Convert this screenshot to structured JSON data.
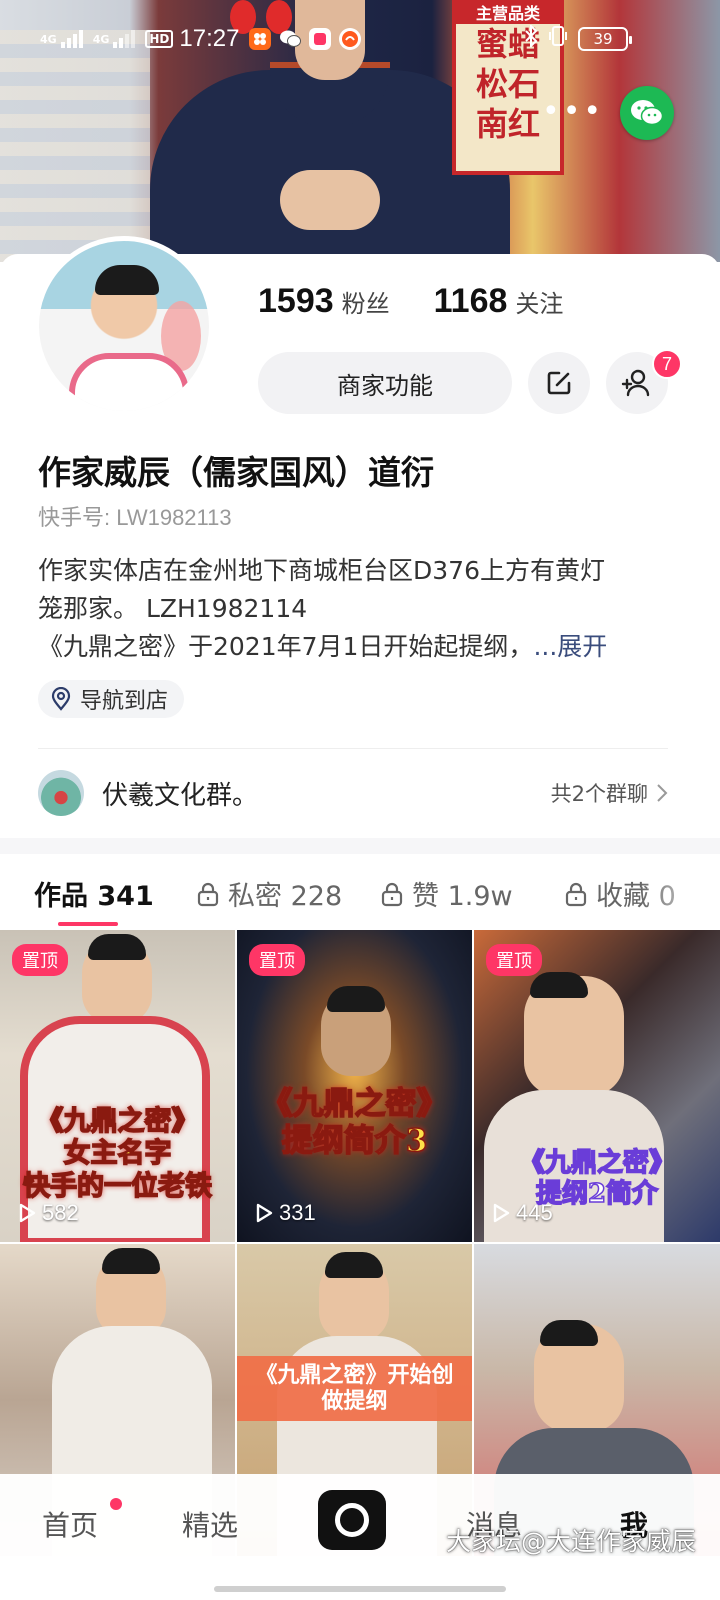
{
  "status_bar": {
    "network1": "4G",
    "network2": "4G",
    "hd": "HD",
    "time": "17:27",
    "battery": "39"
  },
  "cover": {
    "sign_top": "主营品类",
    "sign_lines": [
      "蜜蜡",
      "松石",
      "南红"
    ]
  },
  "profile": {
    "followers_count": "1593",
    "followers_label": "粉丝",
    "following_count": "1168",
    "following_label": "关注",
    "merchant_button": "商家功能",
    "friend_badge": "7",
    "name": "作家威辰（儒家国风）道衍",
    "kuaishou_id": "快手号: LW1982113",
    "bio_line1": "作家实体店在金州地下商城柜台区D376上方有黄灯",
    "bio_line2": "笼那家。   LZH1982114",
    "bio_line3": "《九鼎之密》于2021年7月1日开始起提纲，",
    "bio_expand": "...展开",
    "nav_to_store": "导航到店"
  },
  "group": {
    "name": "伏羲文化群。",
    "count": "共2个群聊"
  },
  "tabs": [
    {
      "label": "作品 341"
    },
    {
      "label": "私密 228"
    },
    {
      "label": "赞 1.9w"
    },
    {
      "label": "收藏 0"
    }
  ],
  "videos": [
    {
      "pinned": "置顶",
      "caption": [
        "《九鼎之密》",
        "女主名字",
        "快手的一位老铁"
      ],
      "plays": "582"
    },
    {
      "pinned": "置顶",
      "caption": [
        "《九鼎之密》",
        "提纲简介3"
      ],
      "plays": "331"
    },
    {
      "pinned": "置顶",
      "caption": [
        "《九鼎之密》",
        "提纲2简介"
      ],
      "plays": "445"
    },
    {
      "pinned": "",
      "caption": [],
      "plays": ""
    },
    {
      "pinned": "",
      "caption": [
        "《九鼎之密》开始创",
        "做提纲"
      ],
      "plays": ""
    },
    {
      "pinned": "",
      "caption": [],
      "plays": ""
    }
  ],
  "bottom_nav": {
    "home": "首页",
    "featured": "精选",
    "messages": "消息",
    "me": "我"
  },
  "watermark": "大家坛@大连作家威辰",
  "colors": {
    "accent": "#fe3666",
    "wechat": "#1db954",
    "link": "#3a4c7c"
  }
}
